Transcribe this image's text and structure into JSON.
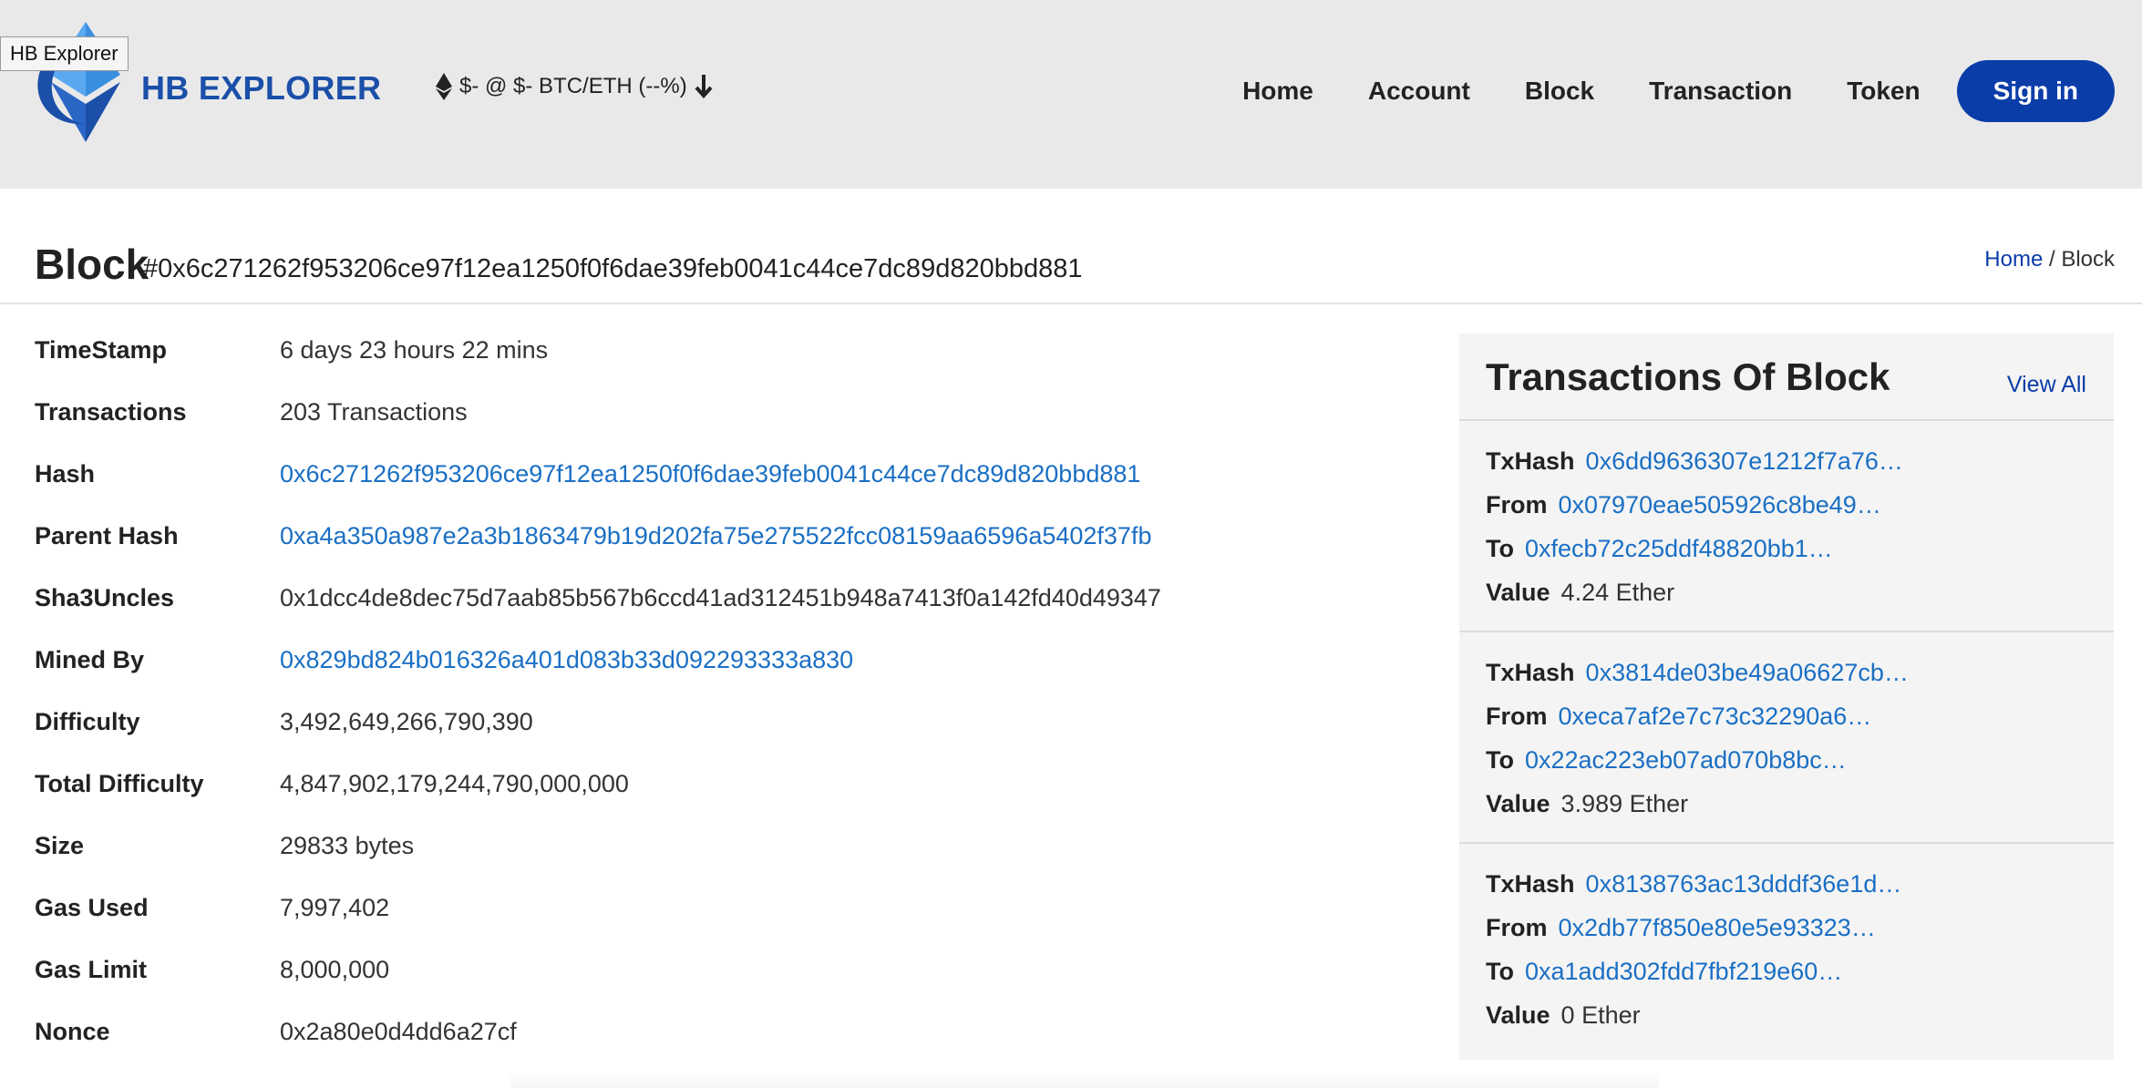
{
  "tooltip": "HB Explorer",
  "brand": {
    "name": "HB EXPLORER",
    "colors": {
      "primary": "#1b4fa8",
      "accent": "#3a8fe0"
    }
  },
  "ticker": {
    "icon": "ethereum-icon",
    "text": "$- @ $- BTC/ETH (--%)",
    "trend_icon": "arrow-down-icon"
  },
  "nav": {
    "items": [
      "Home",
      "Account",
      "Block",
      "Transaction",
      "Token"
    ],
    "signin": "Sign in"
  },
  "title": {
    "label": "Block",
    "hash": "#0x6c271262f953206ce97f12ea1250f0f6dae39feb0041c44ce7dc89d820bbd881"
  },
  "breadcrumb": {
    "home": "Home",
    "separator": "/",
    "current": "Block"
  },
  "details": [
    {
      "label": "TimeStamp",
      "value": "6 days 23 hours 22 mins"
    },
    {
      "label": "Transactions",
      "value": "203 Transactions"
    },
    {
      "label": "Hash",
      "value": "0x6c271262f953206ce97f12ea1250f0f6dae39feb0041c44ce7dc89d820bbd881"
    },
    {
      "label": "Parent Hash",
      "value": "0xa4a350a987e2a3b1863479b19d202fa75e275522fcc08159aa6596a5402f37fb"
    },
    {
      "label": "Sha3Uncles",
      "value": "0x1dcc4de8dec75d7aab85b567b6ccd41ad312451b948a7413f0a142fd40d49347"
    },
    {
      "label": "Mined By",
      "value": "0x829bd824b016326a401d083b33d092293333a830"
    },
    {
      "label": "Difficulty",
      "value": "3,492,649,266,790,390"
    },
    {
      "label": "Total Difficulty",
      "value": "4,847,902,179,244,790,000,000"
    },
    {
      "label": "Size",
      "value": "29833 bytes"
    },
    {
      "label": "Gas Used",
      "value": "7,997,402"
    },
    {
      "label": "Gas Limit",
      "value": "8,000,000"
    },
    {
      "label": "Nonce",
      "value": "0x2a80e0d4dd6a27cf"
    }
  ],
  "panel": {
    "title": "Transactions Of Block",
    "view_all": "View All",
    "labels": {
      "txhash": "TxHash",
      "from": "From",
      "to": "To",
      "value": "Value"
    },
    "transactions": [
      {
        "txhash": "0x6dd9636307e1212f7a76…",
        "from": "0x07970eae505926c8be49…",
        "to": "0xfecb72c25ddf48820bb1…",
        "value": "4.24 Ether"
      },
      {
        "txhash": "0x3814de03be49a06627cb…",
        "from": "0xeca7af2e7c73c32290a6…",
        "to": "0x22ac223eb07ad070b8bc…",
        "value": "3.989 Ether"
      },
      {
        "txhash": "0x8138763ac13dddf36e1d…",
        "from": "0x2db77f850e80e5e93323…",
        "to": "0xa1add302fdd7fbf219e60…",
        "value": "0 Ether"
      }
    ]
  }
}
